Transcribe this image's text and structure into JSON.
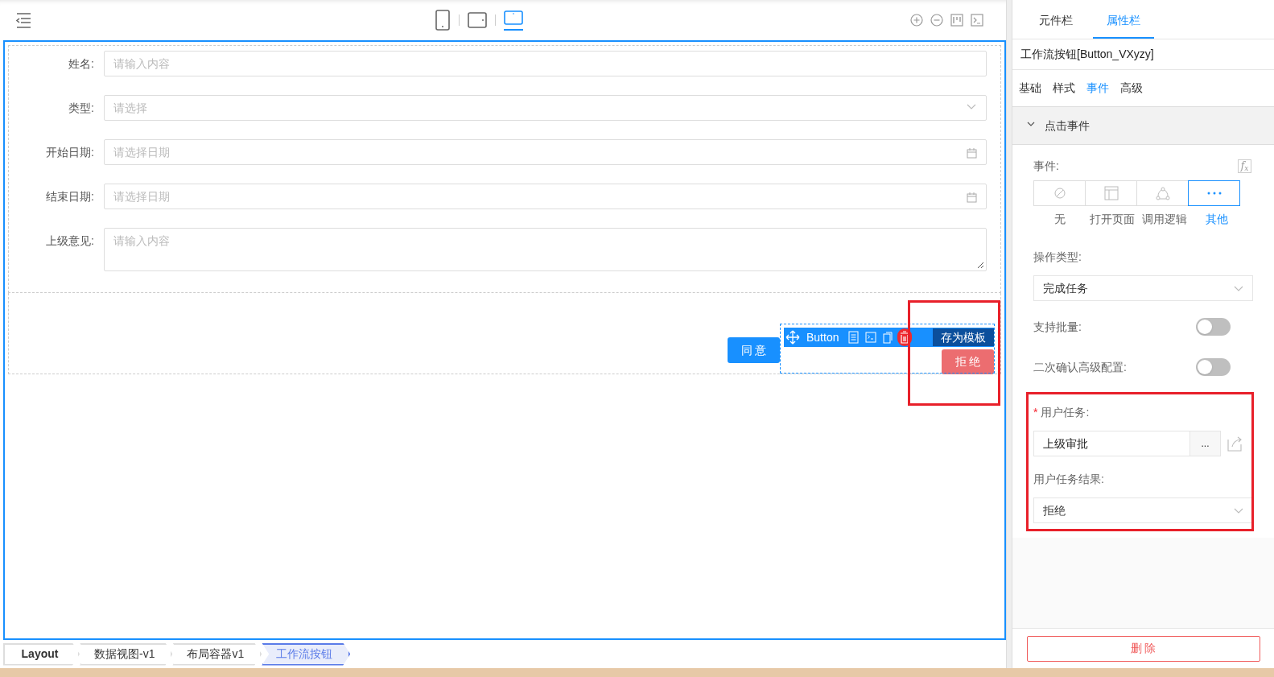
{
  "toolbar": {
    "devices": [
      {
        "kind": "phone",
        "selected": false
      },
      {
        "kind": "tablet",
        "selected": false
      },
      {
        "kind": "desktop",
        "selected": true
      }
    ],
    "actions": [
      {
        "kind": "zoom-in"
      },
      {
        "kind": "zoom-out"
      },
      {
        "kind": "layout"
      },
      {
        "kind": "console"
      }
    ]
  },
  "form": {
    "fields": [
      {
        "label": "姓名:",
        "kind": "input",
        "placeholder": "请输入内容"
      },
      {
        "label": "类型:",
        "kind": "select",
        "placeholder": "请选择"
      },
      {
        "label": "开始日期:",
        "kind": "date",
        "placeholder": "请选择日期"
      },
      {
        "label": "结束日期:",
        "kind": "date",
        "placeholder": "请选择日期"
      },
      {
        "label": "上级意见:",
        "kind": "textarea",
        "placeholder": "请输入内容"
      }
    ]
  },
  "buttons": [
    {
      "label": "同 意",
      "kind": "primary"
    },
    {
      "label": "拒 绝",
      "kind": "danger"
    }
  ],
  "selection_toolbar": {
    "label": "Button",
    "template_button": "存为模板"
  },
  "breadcrumb": [
    {
      "label": "Layout",
      "selected": false
    },
    {
      "label": "数据视图-v1",
      "selected": false
    },
    {
      "label": "布局容器v1",
      "selected": false
    },
    {
      "label": "工作流按钮",
      "selected": true
    }
  ],
  "panel": {
    "tabs": [
      {
        "label": "元件栏",
        "selected": false
      },
      {
        "label": "属性栏",
        "selected": true
      }
    ],
    "component_title": "工作流按钮[Button_VXyzy]",
    "subtabs": [
      {
        "label": "基础",
        "selected": false
      },
      {
        "label": "样式",
        "selected": false
      },
      {
        "label": "事件",
        "selected": true
      },
      {
        "label": "高级",
        "selected": false
      }
    ],
    "section": {
      "title": "点击事件",
      "expanded": true
    },
    "event_label": "事件:",
    "formula_button": "f$_{x}$",
    "event_options": [
      {
        "label": "无",
        "kind": "none",
        "selected": false
      },
      {
        "label": "打开页面",
        "kind": "page",
        "selected": false
      },
      {
        "label": "调用逻辑",
        "kind": "logic",
        "selected": false
      },
      {
        "label": "其他",
        "kind": "more",
        "selected": true
      }
    ],
    "operation_type": {
      "label": "操作类型:",
      "value": "完成任务"
    },
    "switches": [
      {
        "label": "支持批量:",
        "on": false
      },
      {
        "label": "二次确认高级配置:",
        "on": false
      }
    ],
    "user_task": {
      "label": "用户任务:",
      "required": true,
      "required_mark": "*",
      "value": "上级审批",
      "picker": "..."
    },
    "task_result": {
      "label": "用户任务结果:",
      "value": "拒绝"
    },
    "delete_button": "删 除"
  }
}
